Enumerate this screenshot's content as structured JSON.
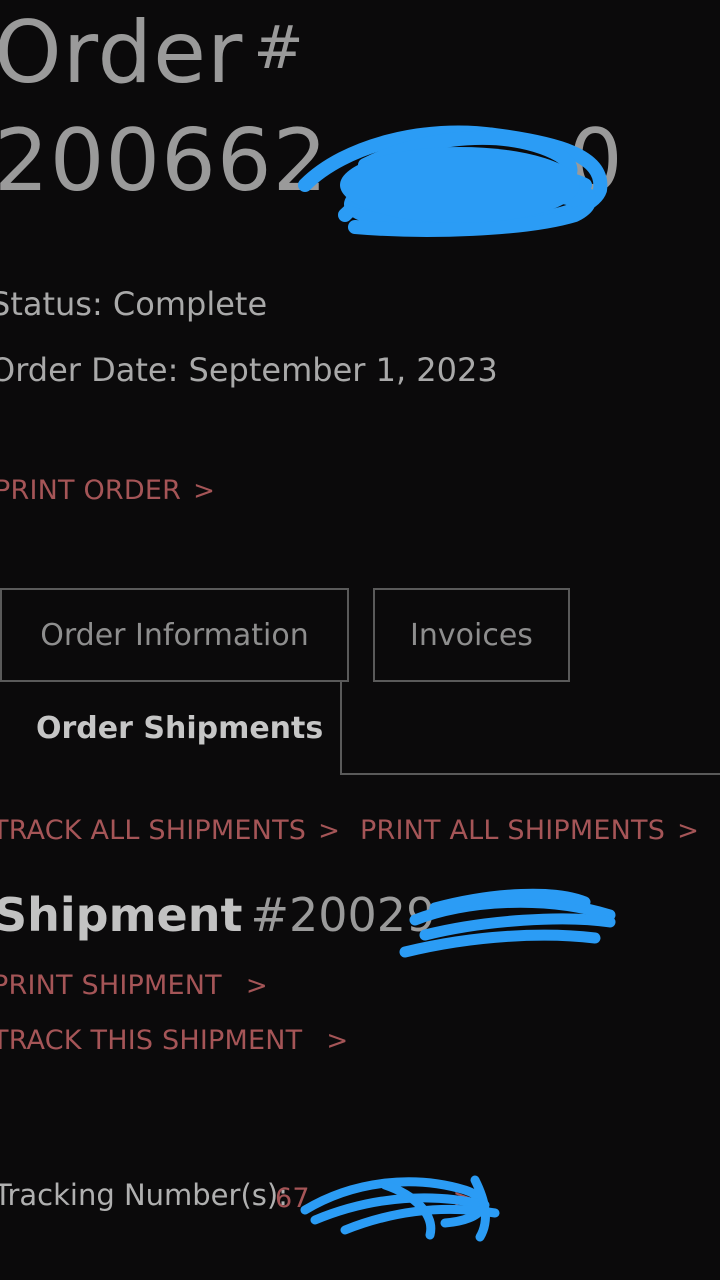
{
  "order": {
    "title": "Order",
    "hash": "#",
    "number_visible": "200662",
    "number_tail": "0",
    "status": "Status: Complete",
    "order_date": "Order Date: September 1, 2023"
  },
  "actions": {
    "print_order": "PRINT ORDER",
    "chevron": ">"
  },
  "tabs": [
    {
      "label": "Order Information",
      "active": false
    },
    {
      "label": "Invoices",
      "active": false
    },
    {
      "label": "Order Shipments",
      "active": true
    }
  ],
  "shipments_actions": {
    "track_all": "TRACK ALL SHIPMENTS",
    "print_all": "PRINT ALL SHIPMENTS"
  },
  "shipment": {
    "label": "Shipment",
    "number_visible": "#20029",
    "print": "PRINT SHIPMENT",
    "track": "TRACK THIS SHIPMENT",
    "tracking_label": "Tracking Number(s):",
    "tracking_visible": "67"
  },
  "colors": {
    "background": "#0b0a0b",
    "link": "#a55557",
    "redaction": "#2b9cf5"
  },
  "icons": [
    "chevron-right-icon"
  ]
}
